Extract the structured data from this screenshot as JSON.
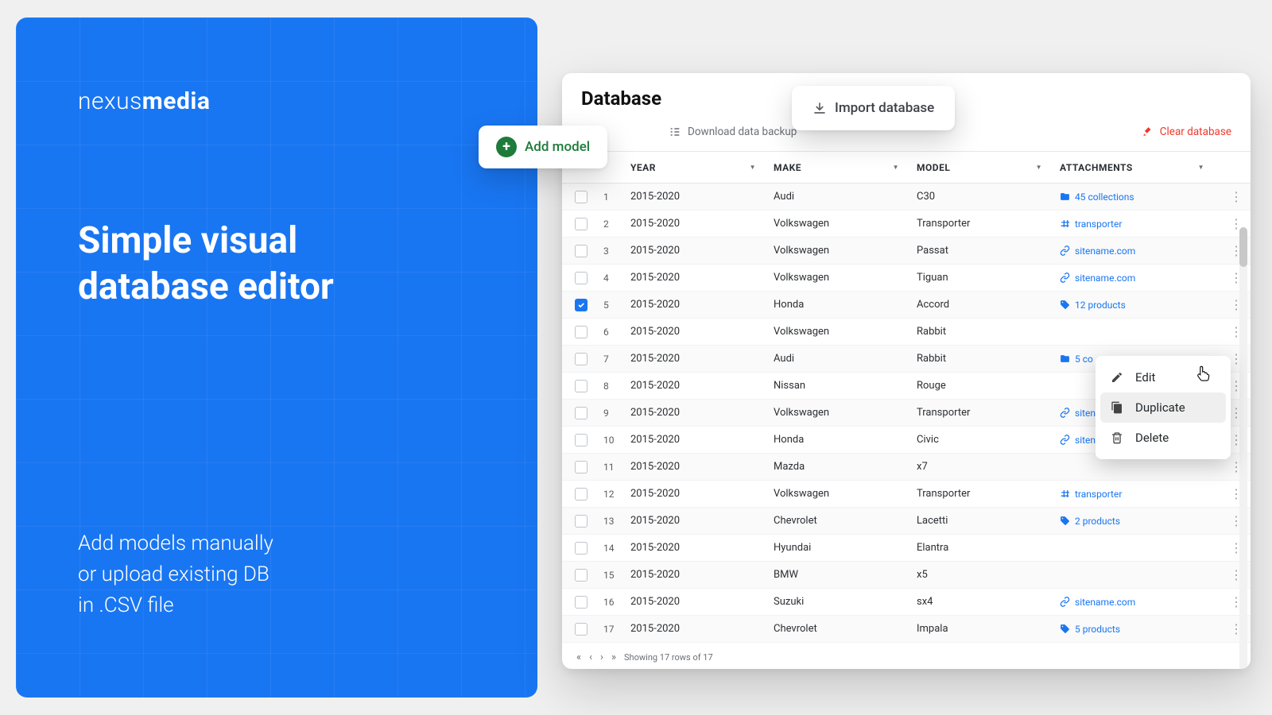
{
  "brand": {
    "light": "nexus",
    "bold": "media"
  },
  "headline1": "Simple visual",
  "headline2": "database editor",
  "subhead1": "Add models manually",
  "subhead2": "or upload existing DB",
  "subhead3": "in .CSV file",
  "page": {
    "title": "Database"
  },
  "toolbar": {
    "add": "Add model",
    "import": "Import database",
    "backup": "Download data backup",
    "clear": "Clear database"
  },
  "columns": {
    "year": "YEAR",
    "make": "MAKE",
    "model": "MODEL",
    "attach": "ATTACHMENTS"
  },
  "rows": [
    {
      "i": "1",
      "year": "2015-2020",
      "make": "Audi",
      "model": "C30",
      "attType": "coll",
      "att": "45 collections",
      "checked": false
    },
    {
      "i": "2",
      "year": "2015-2020",
      "make": "Volkswagen",
      "model": "Transporter",
      "attType": "tag",
      "att": "transporter",
      "checked": false
    },
    {
      "i": "3",
      "year": "2015-2020",
      "make": "Volkswagen",
      "model": "Passat",
      "attType": "link",
      "att": "sitename.com",
      "checked": false
    },
    {
      "i": "4",
      "year": "2015-2020",
      "make": "Volkswagen",
      "model": "Tiguan",
      "attType": "link",
      "att": "sitename.com",
      "checked": false
    },
    {
      "i": "5",
      "year": "2015-2020",
      "make": "Honda",
      "model": "Accord",
      "attType": "prod",
      "att": "12 products",
      "checked": true
    },
    {
      "i": "6",
      "year": "2015-2020",
      "make": "Volkswagen",
      "model": "Rabbit",
      "attType": "",
      "att": "",
      "checked": false
    },
    {
      "i": "7",
      "year": "2015-2020",
      "make": "Audi",
      "model": "Rabbit",
      "attType": "coll",
      "att": "5 co",
      "checked": false
    },
    {
      "i": "8",
      "year": "2015-2020",
      "make": "Nissan",
      "model": "Rouge",
      "attType": "",
      "att": "",
      "checked": false
    },
    {
      "i": "9",
      "year": "2015-2020",
      "make": "Volkswagen",
      "model": "Transporter",
      "attType": "link",
      "att": "siten",
      "checked": false
    },
    {
      "i": "10",
      "year": "2015-2020",
      "make": "Honda",
      "model": "Civic",
      "attType": "link",
      "att": "sitename.com",
      "checked": false
    },
    {
      "i": "11",
      "year": "2015-2020",
      "make": "Mazda",
      "model": "x7",
      "attType": "",
      "att": "",
      "checked": false
    },
    {
      "i": "12",
      "year": "2015-2020",
      "make": "Volkswagen",
      "model": "Transporter",
      "attType": "tag",
      "att": "transporter",
      "checked": false
    },
    {
      "i": "13",
      "year": "2015-2020",
      "make": "Chevrolet",
      "model": "Lacetti",
      "attType": "prod",
      "att": "2 products",
      "checked": false
    },
    {
      "i": "14",
      "year": "2015-2020",
      "make": "Hyundai",
      "model": "Elantra",
      "attType": "",
      "att": "",
      "checked": false
    },
    {
      "i": "15",
      "year": "2015-2020",
      "make": "BMW",
      "model": "x5",
      "attType": "",
      "att": "",
      "checked": false
    },
    {
      "i": "16",
      "year": "2015-2020",
      "make": "Suzuki",
      "model": "sx4",
      "attType": "link",
      "att": "sitename.com",
      "checked": false
    },
    {
      "i": "17",
      "year": "2015-2020",
      "make": "Chevrolet",
      "model": "Impala",
      "attType": "prod",
      "att": "5 products",
      "checked": false
    }
  ],
  "footer": {
    "summary": "Showing 17 rows of 17"
  },
  "ctx": {
    "edit": "Edit",
    "dup": "Duplicate",
    "del": "Delete"
  }
}
